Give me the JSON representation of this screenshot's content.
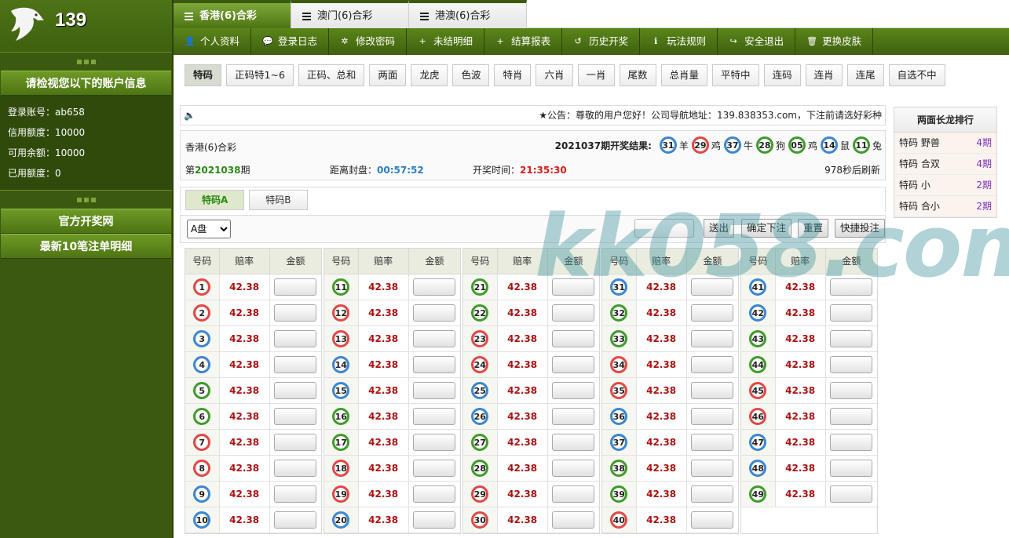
{
  "brand": {
    "number": "139"
  },
  "sidebar": {
    "account_header": "请检视您以下的账户信息",
    "account_rows": [
      {
        "label": "登录账号：ab658"
      },
      {
        "label": "信用额度：10000"
      },
      {
        "label": "可用余额：10000"
      },
      {
        "label": "已用额度：0"
      }
    ],
    "links": [
      "官方开奖网",
      "最新10笔注单明细"
    ]
  },
  "top_tabs": [
    "香港(6)合彩",
    "澳门(6)合彩",
    "港澳(6)合彩"
  ],
  "menu": [
    {
      "icon": "user-icon",
      "glyph": "👤",
      "label": "个人资料"
    },
    {
      "icon": "chat-icon",
      "glyph": "💬",
      "label": "登录日志"
    },
    {
      "icon": "gear-icon",
      "glyph": "✲",
      "label": "修改密码"
    },
    {
      "icon": "plus-icon",
      "glyph": "+",
      "label": "未结明细"
    },
    {
      "icon": "plus-icon",
      "glyph": "+",
      "label": "结算报表"
    },
    {
      "icon": "history-icon",
      "glyph": "↺",
      "label": "历史开奖"
    },
    {
      "icon": "info-icon",
      "glyph": "ℹ",
      "label": "玩法规则"
    },
    {
      "icon": "logout-icon",
      "glyph": "↪",
      "label": "安全退出"
    },
    {
      "icon": "trash-icon",
      "glyph": "🗑",
      "label": "更换皮肤"
    }
  ],
  "sub_tabs": [
    "特码",
    "正码特1~6",
    "正码、总和",
    "两面",
    "龙虎",
    "色波",
    "特肖",
    "六肖",
    "一肖",
    "尾数",
    "总肖量",
    "平特中",
    "连码",
    "连肖",
    "连尾",
    "自选不中"
  ],
  "notice": "★公告：尊敬的用户您好！公司导航地址：139.838353.com，下注前请选好彩种",
  "draw": {
    "lottery": "香港(6)合彩",
    "result_label": "2021037期开奖结果:",
    "results": [
      {
        "num": "31",
        "color": "blue",
        "zodiac": "羊"
      },
      {
        "num": "29",
        "color": "red",
        "zodiac": "鸡"
      },
      {
        "num": "37",
        "color": "blue",
        "zodiac": "牛"
      },
      {
        "num": "28",
        "color": "green",
        "zodiac": "狗"
      },
      {
        "num": "05",
        "color": "green",
        "zodiac": "鸡"
      },
      {
        "num": "14",
        "color": "blue",
        "zodiac": "鼠"
      },
      {
        "num": "11",
        "color": "green",
        "zodiac": "兔"
      }
    ],
    "issue_prefix": "第",
    "issue": "2021038",
    "issue_suffix": "期",
    "close_label": "距离封盘：",
    "close_time": "00:57:52",
    "open_label": "开奖时间：",
    "open_time": "21:35:30",
    "refresh": "978秒后刷新"
  },
  "ranking": {
    "title": "两面长龙排行",
    "rows": [
      {
        "label": "特码 野兽",
        "value": "4期"
      },
      {
        "label": "特码 合双",
        "value": "4期"
      },
      {
        "label": "特码 小",
        "value": "2期"
      },
      {
        "label": "特码 合小",
        "value": "2期"
      }
    ]
  },
  "type_tabs": [
    "特码A",
    "特码B"
  ],
  "toolbar": {
    "pan": "A盘",
    "send": "送出",
    "confirm": "确定下注",
    "reset": "重置",
    "quick": "快捷投注"
  },
  "grid": {
    "headers": [
      "号码",
      "赔率",
      "金额"
    ],
    "odds": "42.38",
    "reds": [
      1,
      2,
      7,
      8,
      12,
      13,
      18,
      19,
      23,
      24,
      29,
      30,
      34,
      35,
      40,
      45,
      46
    ],
    "blues": [
      3,
      4,
      9,
      10,
      14,
      15,
      20,
      25,
      26,
      31,
      36,
      37,
      41,
      42,
      47,
      48
    ],
    "greens": [
      5,
      6,
      11,
      16,
      17,
      21,
      22,
      27,
      28,
      32,
      33,
      38,
      39,
      43,
      44,
      49
    ]
  },
  "watermark": "kk058.com"
}
